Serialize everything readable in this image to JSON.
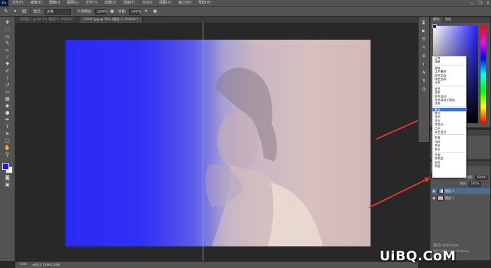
{
  "app": {
    "logo": "Ps"
  },
  "menu": [
    "文件(F)",
    "编辑(E)",
    "图像(I)",
    "图层(L)",
    "文字(Y)",
    "选择(S)",
    "滤镜(T)",
    "3D(D)",
    "视图(V)",
    "窗口(W)",
    "帮助(H)"
  ],
  "window_controls": {
    "minimize": "—",
    "restore": "❐",
    "close": "✕"
  },
  "options_bar": {
    "mode_label": "模式:",
    "mode_value": "正常",
    "opacity_label": "不透明度:",
    "opacity_value": "100%",
    "flow_label": "流量:",
    "flow_value": "100%"
  },
  "tabs": [
    {
      "label": "未标题-1 @ 66.7% (图层 1, RGB/8) *",
      "active": false
    },
    {
      "label": "15040.jpg @ 50% (图层 2, RGB/8) *",
      "active": true
    }
  ],
  "tools": [
    "move",
    "marquee",
    "lasso",
    "quick-select",
    "crop",
    "eyedropper",
    "heal",
    "brush",
    "stamp",
    "history-brush",
    "eraser",
    "gradient",
    "blur",
    "dodge",
    "pen",
    "type",
    "path-select",
    "shape",
    "hand",
    "zoom"
  ],
  "colors": {
    "foreground": "#1a1aff",
    "background": "#ffffff",
    "guide": "#31d0c8",
    "arrow": "#e23a2a",
    "highlight": "#3f6fd0"
  },
  "color_panel": {
    "tab_color": "颜色",
    "tab_swatches": "色板"
  },
  "adjustments_panel": {
    "tab_label": "调整"
  },
  "layers_panel": {
    "tab_label": "图层",
    "kind_label": "类型",
    "opacity_label": "不透明度:",
    "opacity_value": "100%",
    "fill_label": "填充:",
    "fill_value": "100%",
    "layers": [
      {
        "name": "图层 2",
        "selected": true
      },
      {
        "name": "图层 1",
        "selected": false
      }
    ]
  },
  "blend_dropdown": {
    "current": "正常",
    "groups": [
      [
        "正常",
        "溶解"
      ],
      [
        "变暗",
        "正片叠底",
        "颜色加深",
        "线性加深",
        "深色"
      ],
      [
        "变亮",
        "滤色",
        "颜色减淡",
        "线性减淡 (添加)",
        "浅色"
      ],
      [
        "叠加",
        "柔光",
        "强光",
        "亮光",
        "线性光",
        "点光",
        "实色混合"
      ],
      [
        "差值",
        "排除",
        "减去",
        "划分"
      ],
      [
        "色相",
        "饱和度",
        "颜色",
        "明度"
      ]
    ],
    "highlighted": "叠加"
  },
  "status_bar": {
    "zoom": "50%",
    "doc": "文档:2.71M/5.42M"
  },
  "watermarks": {
    "windows_line1": "激活 Windows",
    "windows_line2": "转到“设置”以激活 Windows。",
    "site": "UiBQ.CoM"
  }
}
